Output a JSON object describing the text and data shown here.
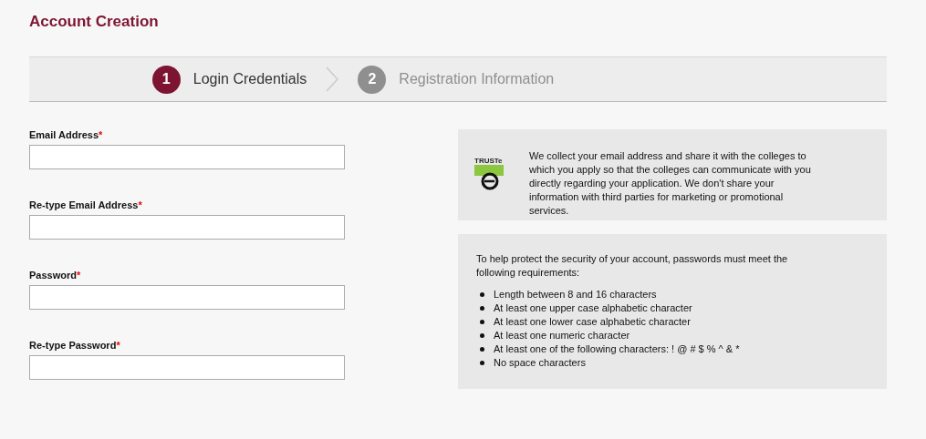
{
  "title": "Account Creation",
  "steps": [
    {
      "number": "1",
      "label": "Login Credentials",
      "selected": true
    },
    {
      "number": "2",
      "label": "Registration Information",
      "selected": false
    }
  ],
  "fields": [
    {
      "label": "Email Address",
      "required_mark": "*"
    },
    {
      "label": "Re-type Email Address",
      "required_mark": "*"
    },
    {
      "label": "Password",
      "required_mark": "*"
    },
    {
      "label": "Re-type Password",
      "required_mark": "*"
    }
  ],
  "privacy": {
    "seal": "TRUSTe",
    "text": "We collect your email address and share it with the colleges to which you apply so that the colleges can communicate with you directly regarding your application. We don't share your information with third parties for marketing or promotional services."
  },
  "requirements": {
    "intro": "To help protect the security of your account, passwords must meet the following requirements:",
    "items": [
      "Length between 8 and 16 characters",
      "At least one upper case alphabetic character",
      "At least one lower case alphabetic character",
      "At least one numeric character",
      "At least one of the following characters: ! @ # $ % ^ & *",
      "No space characters"
    ]
  }
}
